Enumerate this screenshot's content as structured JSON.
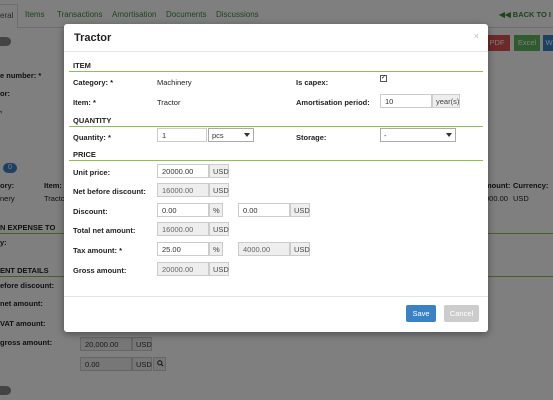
{
  "background": {
    "tabs": [
      "eral",
      "Items",
      "Transactions",
      "Amortisation",
      "Documents",
      "Discussions"
    ],
    "back_link": "BACK TO I",
    "back_icon": "double-left-arrow-icon",
    "export_buttons": [
      "PDF",
      "Excel",
      "W"
    ],
    "colors": {
      "pdf": "#d9534f",
      "excel": "#5cb85c",
      "word": "#3b82c4"
    },
    "labels": {
      "number": "e number: *",
      "or": "or:",
      "comma": ",",
      "category": "ory:",
      "item": "Item:",
      "amount": "mount:",
      "currency": "Currency:",
      "expense_to": "N EXPENSE TO",
      "y": "y:",
      "ent_details": "ENT DETAILS",
      "before_discount": "efore discount:",
      "net_amount": "net amount:",
      "vat_amount": "VAT amount:",
      "gross_amount": "gross amount:"
    },
    "row": {
      "category": "nery",
      "item": "Tracto",
      "amount": "000.00",
      "currency": "USD"
    },
    "circle_label": "0",
    "gross_value": "20,000.00",
    "gross_currency": "USD",
    "extra_value": "0.00",
    "extra_currency": "USD",
    "search_icon": "search-icon"
  },
  "modal": {
    "title": "Tractor",
    "close": "×",
    "item_section": "ITEM",
    "category_label": "Category: *",
    "category_value": "Machinery",
    "is_capex_label": "Is capex:",
    "is_capex_checked": "✓",
    "item_label": "Item: *",
    "item_value": "Tractor",
    "amortisation_label": "Amortisation period:",
    "amortisation_value": "10",
    "amortisation_unit": "year(s)",
    "quantity_section": "QUANTITY",
    "quantity_label": "Quantity: *",
    "quantity_value": "1",
    "quantity_unit": "pcs",
    "storage_label": "Storage:",
    "storage_value": "-",
    "price_section": "PRICE",
    "unit_price_label": "Unit price:",
    "unit_price_value": "20000.00",
    "unit_price_currency": "USD",
    "net_before_discount_label": "Net before discount:",
    "net_before_discount_value": "16000.00",
    "net_before_discount_currency": "USD",
    "discount_label": "Discount:",
    "discount_percent_value": "0.00",
    "discount_percent_unit": "%",
    "discount_amount_value": "0.00",
    "discount_amount_currency": "USD",
    "total_net_label": "Total net amount:",
    "total_net_value": "16000.00",
    "total_net_currency": "USD",
    "tax_label": "Tax amount: *",
    "tax_percent_value": "25.00",
    "tax_percent_unit": "%",
    "tax_amount_value": "4000.00",
    "tax_amount_currency": "USD",
    "gross_label": "Gross amount:",
    "gross_value": "20000.00",
    "gross_currency": "USD",
    "save_label": "Save",
    "cancel_label": "Cancel"
  }
}
